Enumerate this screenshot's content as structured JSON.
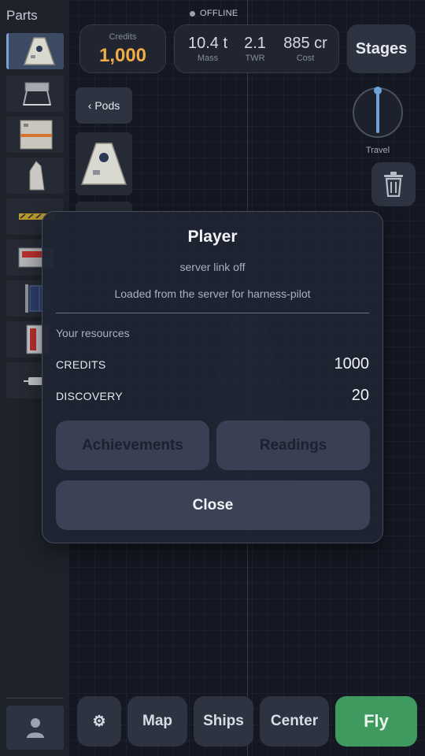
{
  "status": {
    "label": "OFFLINE"
  },
  "sidebar": {
    "title": "Parts",
    "item_count": 9
  },
  "topbar": {
    "credits_label": "Credits",
    "credits_value": "1,000",
    "mass_value": "10.4 t",
    "mass_label": "Mass",
    "twr_value": "2.1",
    "twr_label": "TWR",
    "cost_value": "885 cr",
    "cost_label": "Cost",
    "stages_label": "Stages"
  },
  "category": {
    "pods_label": "‹ Pods"
  },
  "travel": {
    "label": "Travel"
  },
  "modal": {
    "title": "Player",
    "subtitle": "server link off",
    "note": "Loaded from the server for harness-pilot",
    "resources_heading": "Your resources",
    "resources": [
      {
        "label": "CREDITS",
        "value": "1000"
      },
      {
        "label": "DISCOVERY",
        "value": "20"
      }
    ],
    "achievements_label": "Achievements",
    "readings_label": "Readings",
    "close_label": "Close"
  },
  "bottom": {
    "settings_icon": "⚙",
    "map_label": "Map",
    "ships_label": "Ships",
    "center_label": "Center",
    "fly_label": "Fly"
  },
  "colors": {
    "accent_credits": "#f0ac46",
    "fly_green": "#3f9a5f",
    "selected_part": "#3c4a63"
  }
}
